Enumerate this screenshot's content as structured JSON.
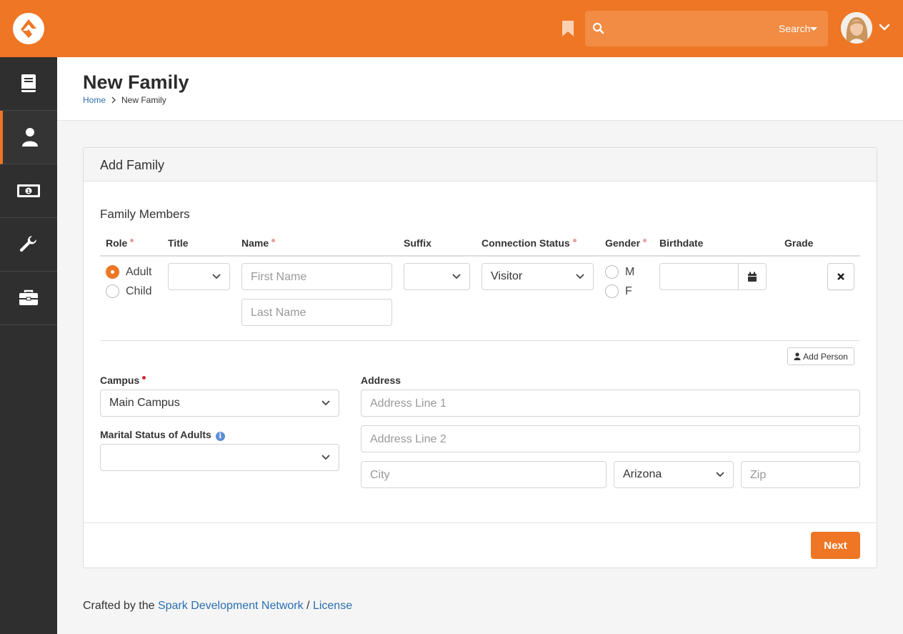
{
  "header": {
    "search": {
      "placeholder": "",
      "label": "Search"
    }
  },
  "sidebar": {
    "items": [
      {
        "icon": "book-icon"
      },
      {
        "icon": "user-icon",
        "active": true
      },
      {
        "icon": "money-icon"
      },
      {
        "icon": "wrench-icon"
      },
      {
        "icon": "briefcase-icon"
      }
    ]
  },
  "page": {
    "title": "New Family",
    "breadcrumb": [
      "Home",
      "New Family"
    ]
  },
  "panel": {
    "title": "Add Family",
    "section_title": "Family Members",
    "columns": {
      "role": "Role",
      "title": "Title",
      "name": "Name",
      "suffix": "Suffix",
      "connection_status": "Connection Status",
      "gender": "Gender",
      "birthdate": "Birthdate",
      "grade": "Grade"
    },
    "member": {
      "role_options": [
        "Adult",
        "Child"
      ],
      "role_selected": "Adult",
      "title_value": "",
      "first_name_placeholder": "First Name",
      "last_name_placeholder": "Last Name",
      "suffix_value": "",
      "connection_status_value": "Visitor",
      "gender_options": [
        "M",
        "F"
      ],
      "birthdate_value": ""
    },
    "add_person_label": "Add Person",
    "campus": {
      "label": "Campus",
      "value": "Main Campus"
    },
    "marital": {
      "label": "Marital Status of Adults",
      "value": ""
    },
    "address": {
      "label": "Address",
      "line1_placeholder": "Address Line 1",
      "line2_placeholder": "Address Line 2",
      "city_placeholder": "City",
      "state_value": "Arizona",
      "zip_placeholder": "Zip"
    },
    "next_label": "Next"
  },
  "footer": {
    "prefix": "Crafted by the",
    "link1": "Spark Development Network",
    "separator": "/",
    "link2": "License"
  },
  "colors": {
    "accent": "#ee7624",
    "sidebar": "#2f2f2f",
    "link": "#2a6fb2"
  }
}
